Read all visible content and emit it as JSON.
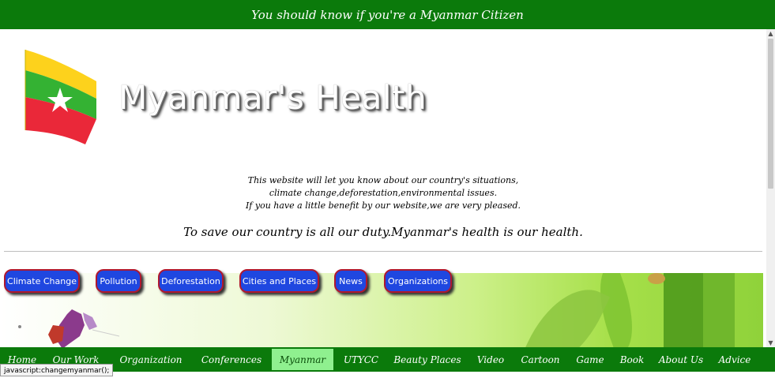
{
  "banner": {
    "text": "You should know if you're a Myanmar Citizen"
  },
  "site": {
    "title": "Myanmar's Health"
  },
  "intro": {
    "lines": [
      "This website will let you know about our country's situations,",
      "climate change,deforestation,environmental issues.",
      "If you have a little benefit by our website,we are very pleased."
    ]
  },
  "tagline": "To save our country is all our duty.Myanmar's health is our health.",
  "category_buttons": [
    "Climate Change",
    "Pollution",
    "Deforestation",
    "Cities and Places",
    "News",
    "Organizations"
  ],
  "nav": {
    "items": [
      "Home",
      "Our Work",
      "Organization",
      "Conferences",
      "Myanmar",
      "UTYCC",
      "Beauty Places",
      "Video",
      "Cartoon",
      "Game",
      "Book",
      "About Us",
      "Advice"
    ],
    "active": "Myanmar"
  },
  "status_bar": "javascript:changemyanmar();",
  "colors": {
    "banner_green": "#0b7a0b",
    "button_blue": "#1f47e0",
    "button_border": "#b0182f",
    "nav_active": "#8ff08f"
  }
}
